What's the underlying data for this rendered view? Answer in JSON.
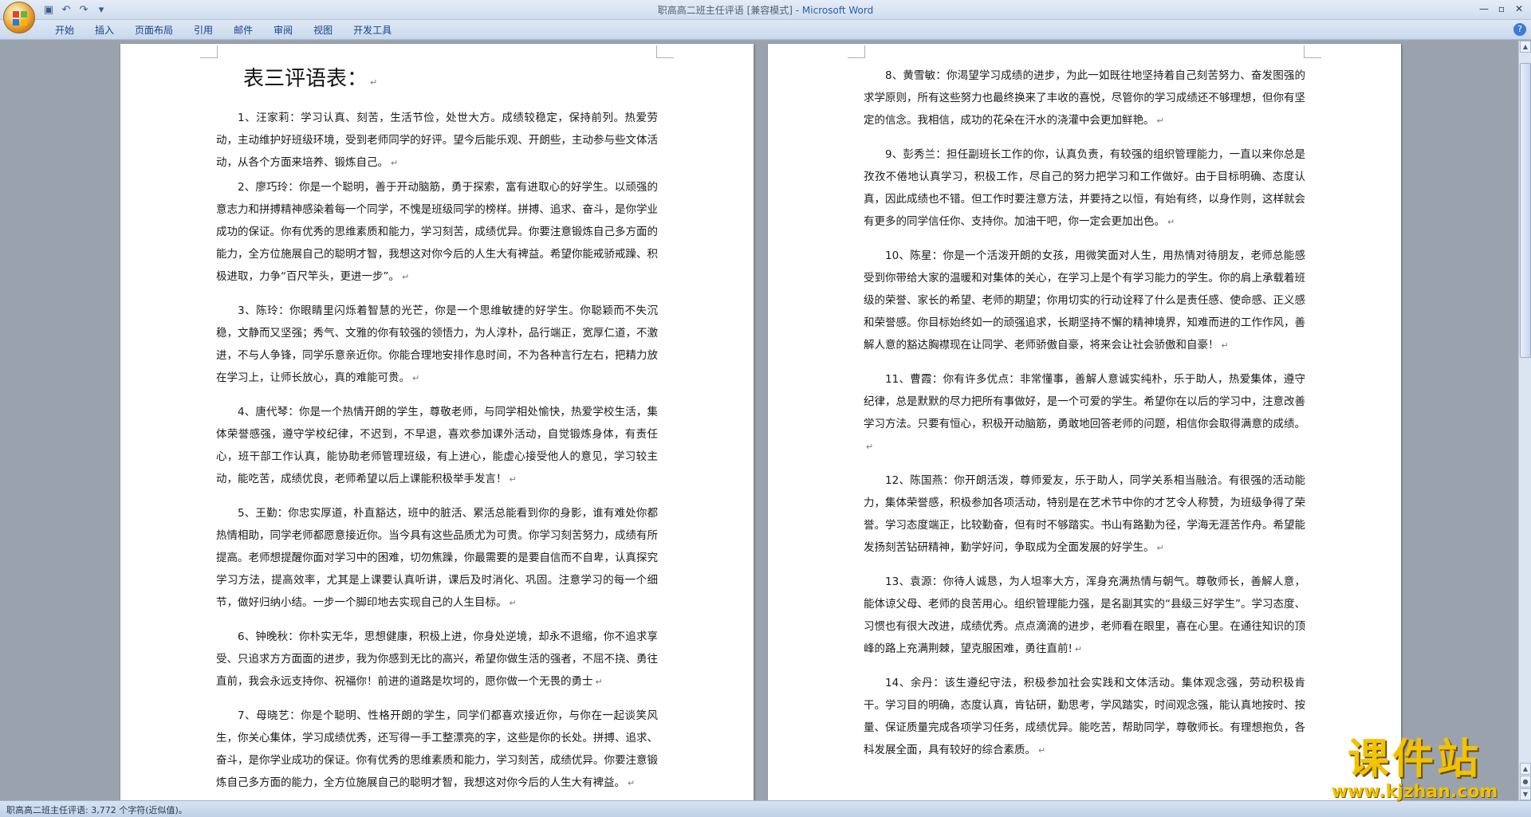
{
  "window": {
    "title": "职高高二班主任评语 [兼容模式] - ",
    "app_name": "Microsoft Word"
  },
  "quick_access": [
    "save-icon",
    "undo-icon",
    "redo-icon",
    "customize-icon"
  ],
  "ribbon": {
    "tabs": [
      "开始",
      "插入",
      "页面布局",
      "引用",
      "邮件",
      "审阅",
      "视图",
      "开发工具"
    ]
  },
  "document": {
    "title": "表三评语表：",
    "page1": [
      "1、汪家莉：学习认真、刻苦，生活节俭，处世大方。成绩较稳定，保持前列。热爱劳动，主动维护好班级环境，受到老师同学的好评。望今后能乐观、开朗些，主动参与些文体活动，从各个方面来培养、锻炼自己。",
      "2、廖巧玲：你是一个聪明，善于开动脑筋，勇于探索，富有进取心的好学生。以顽强的意志力和拼搏精神感染着每一个同学，不愧是班级同学的榜样。拼搏、追求、奋斗，是你学业成功的保证。你有优秀的思维素质和能力，学习刻苦，成绩优异。你要注意锻炼自己多方面的能力，全方位施展自己的聪明才智，我想这对你今后的人生大有裨益。希望你能戒骄戒躁、积极进取，力争“百尺竿头，更进一步”。",
      "3、陈玲：你眼睛里闪烁着智慧的光芒，你是一个思维敏捷的好学生。你聪颖而不失沉稳，文静而又坚强；秀气、文雅的你有较强的领悟力，为人淳朴，品行端正，宽厚仁道，不激进，不与人争锋，同学乐意亲近你。你能合理地安排作息时间，不为各种言行左右，把精力放在学习上，让师长放心，真的难能可贵。",
      "4、唐代琴：你是一个热情开朗的学生，尊敬老师，与同学相处愉快，热爱学校生活，集体荣誉感强，遵守学校纪律，不迟到，不早退，喜欢参加课外活动，自觉锻炼身体，有责任心，班干部工作认真，能协助老师管理班级，有上进心，能虚心接受他人的意见，学习较主动，能吃苦，成绩优良，老师希望以后上课能积极举手发言！",
      "5、王勤：你忠实厚道，朴直豁达，班中的脏活、累活总能看到你的身影，谁有难处你都热情相助，同学老师都愿意接近你。当今具有这些品质尤为可贵。你学习刻苦努力，成绩有所提高。老师想提醒你面对学习中的困难，切勿焦躁，你最需要的是要自信而不自卑，认真探究学习方法，提高效率，尤其是上课要认真听讲，课后及时消化、巩固。注意学习的每一个细节，做好归纳小结。一步一个脚印地去实现自己的人生目标。",
      "6、钟晚秋：你朴实无华，思想健康，积极上进，你身处逆境，却永不退缩，你不追求享受、只追求方方面面的进步，我为你感到无比的高兴，希望你做生活的强者，不屈不挠、勇往直前，我会永远支持你、祝福你！前进的道路是坎坷的，愿你做一个无畏的勇士",
      "7、母晓艺：你是个聪明、性格开朗的学生，同学们都喜欢接近你，与你在一起谈笑风生，你关心集体，学习成绩优秀，还写得一手工整漂亮的字，这些是你的长处。拼搏、追求、奋斗，是你学业成功的保证。你有优秀的思维素质和能力，学习刻苦，成绩优异。你要注意锻炼自己多方面的能力，全方位施展自己的聪明才智，我想这对你今后的人生大有裨益。"
    ],
    "page2": [
      "8、黄雪敏：你渴望学习成绩的进步，为此一如既往地坚持着自己刻苦努力、奋发图强的求学原则，所有这些努力也最终换来了丰收的喜悦，尽管你的学习成绩还不够理想，但你有坚定的信念。我相信，成功的花朵在汗水的浇灌中会更加鲜艳。",
      "9、彭秀兰：担任副班长工作的你，认真负责，有较强的组织管理能力，一直以来你总是孜孜不倦地认真学习，积极工作，尽自己的努力把学习和工作做好。由于目标明确、态度认真，因此成绩也不错。但工作时要注意方法，并要持之以恒，有始有终，以身作则，这样就会有更多的同学信任你、支持你。加油干吧，你一定会更加出色。",
      "10、陈星：你是一个活泼开朗的女孩，用微笑面对人生，用热情对待朋友，老师总能感受到你带给大家的温暖和对集体的关心，在学习上是个有学习能力的学生。你的肩上承载着班级的荣誉、家长的希望、老师的期望；你用切实的行动诠释了什么是责任感、使命感、正义感和荣誉感。你目标始终如一的顽强追求，长期坚持不懈的精神境界，知难而进的工作作风，善解人意的豁达胸襟现在让同学、老师骄傲自豪，将来会让社会骄傲和自豪！",
      "11、曹霞：你有许多优点：非常懂事，善解人意诚实纯朴，乐于助人，热爱集体，遵守纪律，总是默默的尽力把所有事做好，是一个可爱的学生。希望你在以后的学习中，注意改善学习方法。只要有恒心，积极开动脑筋，勇敢地回答老师的问题，相信你会取得满意的成绩。",
      "12、陈国燕：你开朗活泼，尊师爱友，乐于助人，同学关系相当融洽。有很强的活动能力，集体荣誉感，积极参加各项活动，特别是在艺术节中你的才艺令人称赞，为班级争得了荣誉。学习态度端正，比较勤奋，但有时不够踏实。书山有路勤为径，学海无涯苦作舟。希望能发扬刻苦钻研精神，勤学好问，争取成为全面发展的好学生。",
      "13、袁源：你待人诚恳，为人坦率大方，浑身充满热情与朝气。尊敬师长，善解人意，能体谅父母、老师的良苦用心。组织管理能力强，是名副其实的“县级三好学生”。学习态度、习惯也有很大改进，成绩优秀。点点滴滴的进步，老师看在眼里，喜在心里。在通往知识的顶峰的路上充满荆棘，望克服困难，勇往直前!",
      "14、余丹：该生遵纪守法，积极参加社会实践和文体活动。集体观念强，劳动积极肯干。学习目的明确，态度认真，肯钻研，勤思考，学风踏实，时间观念强，能认真地按时、按量、保证质量完成各项学习任务，成绩优异。能吃苦，帮助同学，尊敬师长。有理想抱负，各科发展全面，具有较好的综合素质。"
    ]
  },
  "statusbar": {
    "text": "职高高二班主任评语: 3,772 个字符(近似值)。"
  },
  "watermark": {
    "main": "课件站",
    "url": "www.kjzhan.com"
  }
}
